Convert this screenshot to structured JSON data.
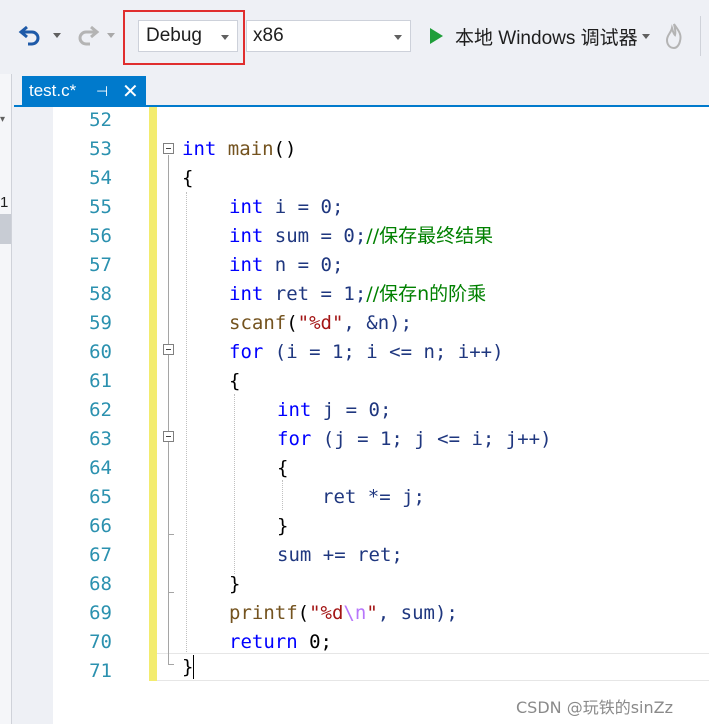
{
  "toolbar": {
    "configuration": "Debug",
    "platform": "x86",
    "run_label": "本地 Windows 调试器"
  },
  "left_panel": {
    "fragment": "1"
  },
  "tab": {
    "title": "test.c*",
    "pin_glyph": "⊣",
    "close_glyph": "✕"
  },
  "editor": {
    "line_numbers": [
      "52",
      "53",
      "54",
      "55",
      "56",
      "57",
      "58",
      "59",
      "60",
      "61",
      "62",
      "63",
      "64",
      "65",
      "66",
      "67",
      "68",
      "69",
      "70",
      "71"
    ]
  },
  "code": {
    "l53_kw": "int",
    "l53_fn": "main",
    "l53_rest": "()",
    "l54": "{",
    "l55_kw": "int",
    "l55_rest": "i = 0;",
    "l56_kw": "int",
    "l56_rest": "sum = 0;",
    "l56_cm": "//保存最终结果",
    "l57_kw": "int",
    "l57_rest": "n = 0;",
    "l58_kw": "int",
    "l58_rest": "ret = 1;",
    "l58_cm": "//保存n的阶乘",
    "l59_fn": "scanf",
    "l59_a": "(",
    "l59_str": "\"%d\"",
    "l59_b": ", &n);",
    "l60_kw": "for",
    "l60_rest": "(i = 1; i <= n; i++)",
    "l61": "{",
    "l62_kw": "int",
    "l62_rest": "j = 0;",
    "l63_kw": "for",
    "l63_rest": "(j = 1; j <= i; j++)",
    "l64": "{",
    "l65": "ret *= j;",
    "l66": "}",
    "l67": "sum += ret;",
    "l68": "}",
    "l69_fn": "printf",
    "l69_a": "(",
    "l69_str1": "\"%d",
    "l69_esc": "\\n",
    "l69_str2": "\"",
    "l69_b": ", sum);",
    "l70_kw": "return",
    "l70_rest": "0;",
    "l71": "}"
  },
  "watermark": "CSDN @玩铁的sinZz",
  "colors": {
    "accent": "#007acc",
    "highlight_box": "#e02e2e",
    "change_bar": "#f3ec6f",
    "keyword": "#0000ff",
    "comment": "#008000"
  }
}
